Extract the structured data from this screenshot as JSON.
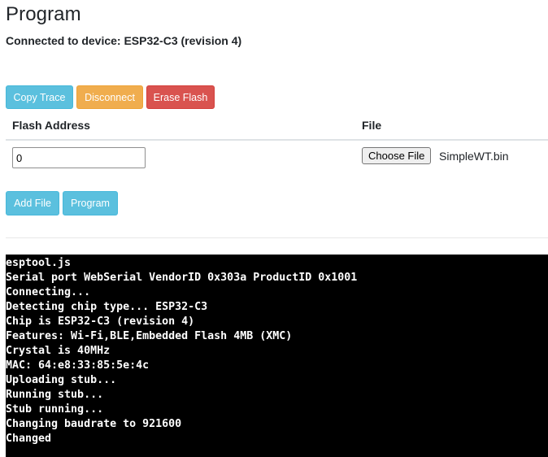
{
  "page": {
    "title": "Program",
    "status": "Connected to device: ESP32-C3 (revision 4)"
  },
  "toolbar": {
    "copy_trace": "Copy Trace",
    "disconnect": "Disconnect",
    "erase_flash": "Erase Flash"
  },
  "table": {
    "headers": [
      "Flash Address",
      "File"
    ],
    "rows": [
      {
        "address": "0",
        "choose_file_label": "Choose File",
        "file_name": "SimpleWT.bin"
      }
    ]
  },
  "actions": {
    "add_file": "Add File",
    "program": "Program"
  },
  "console": {
    "lines": [
      "esptool.js",
      "Serial port WebSerial VendorID 0x303a ProductID 0x1001",
      "Connecting...",
      "Detecting chip type... ESP32-C3",
      "Chip is ESP32-C3 (revision 4)",
      "Features: Wi-Fi,BLE,Embedded Flash 4MB (XMC)",
      "Crystal is 40MHz",
      "MAC: 64:e8:33:85:5e:4c",
      "Uploading stub...",
      "Running stub...",
      "Stub running...",
      "Changing baudrate to 921600",
      "Changed"
    ]
  },
  "colors": {
    "info": "#5bc0de",
    "warning": "#f0ad4e",
    "danger": "#d9534f",
    "console_bg": "#000000",
    "console_text": "#ffffff"
  }
}
